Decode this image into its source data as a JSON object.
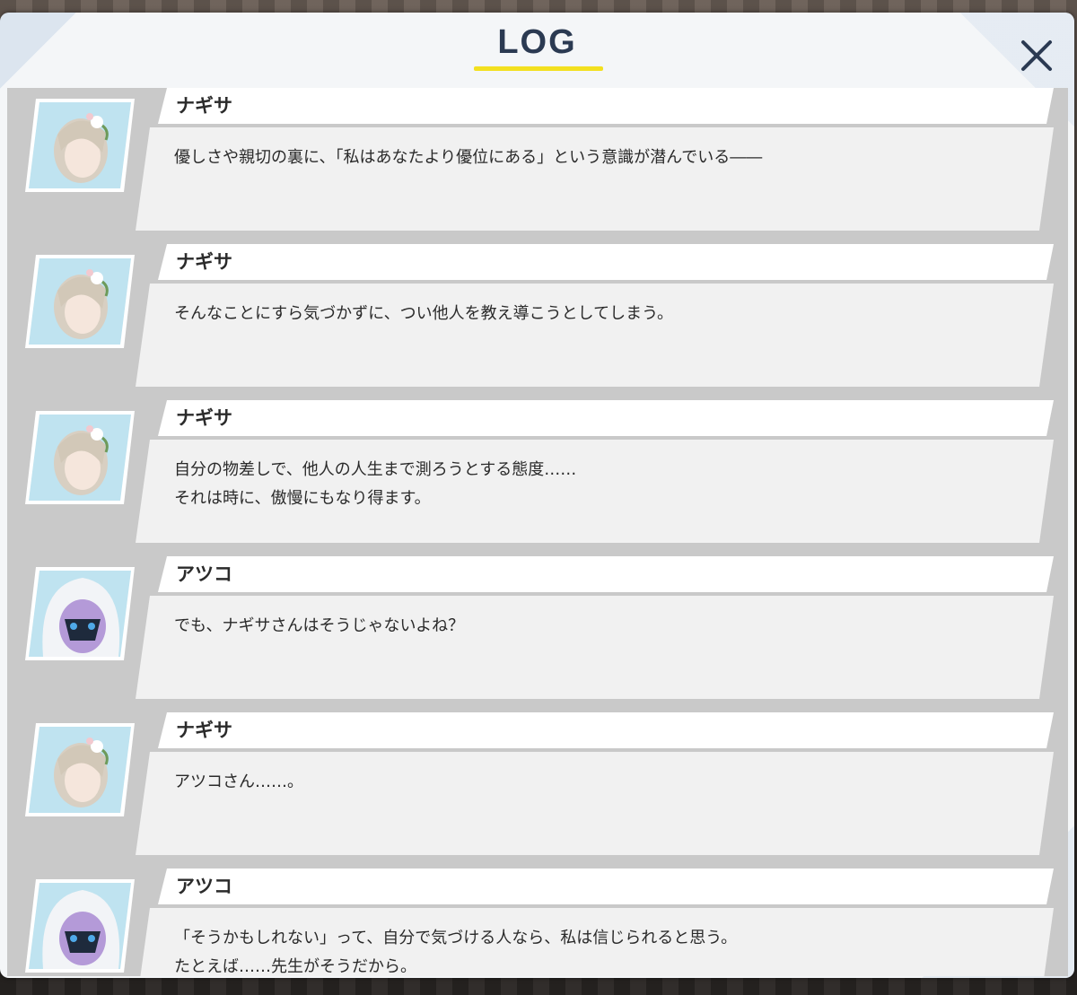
{
  "header": {
    "title": "LOG",
    "accent_color": "#f3e01f"
  },
  "entries": [
    {
      "name": "ナギサ",
      "avatar": "nagisa",
      "text": "優しさや親切の裏に、「私はあなたより優位にある」という意識が潜んでいる――"
    },
    {
      "name": "ナギサ",
      "avatar": "nagisa",
      "text": "そんなことにすら気づかずに、つい他人を教え導こうとしてしまう。"
    },
    {
      "name": "ナギサ",
      "avatar": "nagisa",
      "text": "自分の物差しで、他人の人生まで測ろうとする態度……\nそれは時に、傲慢にもなり得ます。"
    },
    {
      "name": "アツコ",
      "avatar": "atsuko",
      "text": "でも、ナギサさんはそうじゃないよね？"
    },
    {
      "name": "ナギサ",
      "avatar": "nagisa",
      "text": "アツコさん……。"
    },
    {
      "name": "アツコ",
      "avatar": "atsuko",
      "text": "「そうかもしれない」って、自分で気づける人なら、私は信じられると思う。\nたとえば……先生がそうだから。"
    }
  ]
}
